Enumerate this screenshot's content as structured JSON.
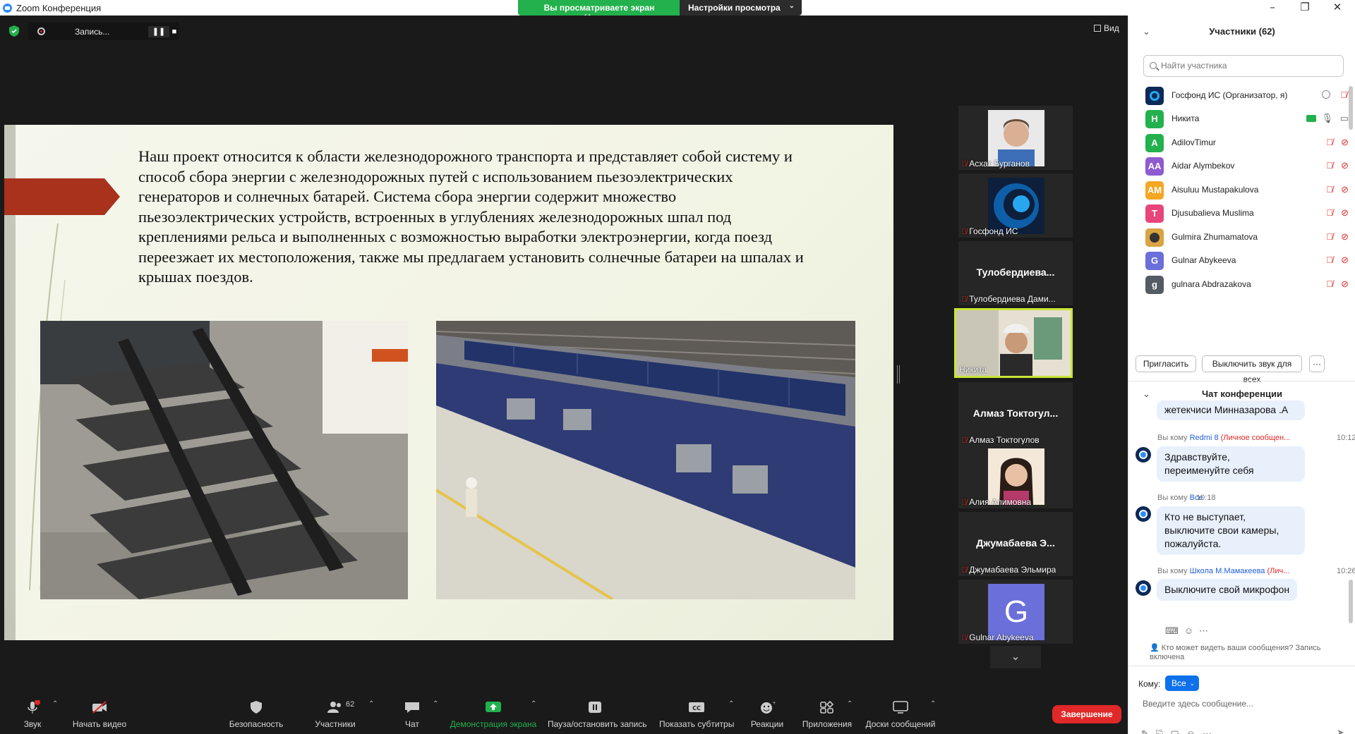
{
  "window": {
    "title": "Zoom Конференция"
  },
  "share_banner": {
    "viewing": "Вы просматриваете экран Никита",
    "options": "Настройки просмотра"
  },
  "recording": {
    "label": "Запись...",
    "pause": "❚❚",
    "stop": "■"
  },
  "view_label": "Вид",
  "slide": {
    "text": "Наш  проект относится к области железнодорожного транспорта и представляет собой систему и способ сбора энергии с железнодорожных путей с использованием пьезоэлектрических генераторов и солнечных батарей. Система сбора энергии содержит множество пьезоэлектрических устройств, встроенных в углублениях железнодорожных шпал под креплениями рельса и выполненных с возможностью выработки электроэнергии, когда поезд переезжает их местоположения, также мы предлагаем установить солнечные батареи на шпалах и крышах поездов."
  },
  "gallery": [
    {
      "name": "Асхат Бурганов",
      "type": "photo",
      "muted": true
    },
    {
      "name": "Госфонд ИС",
      "type": "logo",
      "muted": true
    },
    {
      "name": "Тулобердиева Дами...",
      "big": "Тулобердиева...",
      "type": "text",
      "muted": true
    },
    {
      "name": "Никита",
      "type": "photo-active",
      "muted": false
    },
    {
      "name": "Алмаз Токтогулов",
      "big": "Алмаз Токтогул...",
      "type": "text",
      "muted": true
    },
    {
      "name": "Алия Алимовна",
      "type": "photo",
      "muted": true
    },
    {
      "name": "Джумабаева Эльмира",
      "big": "Джумабаева Э...",
      "type": "text",
      "muted": true
    },
    {
      "name": "Gulnar Abykeeva",
      "type": "letter",
      "letter": "G",
      "muted": true
    }
  ],
  "toolbar": {
    "audio": "Звук",
    "video": "Начать видео",
    "security": "Безопасность",
    "participants": "Участники",
    "participants_count": "62",
    "chat": "Чат",
    "share": "Демонстрация экрана",
    "pause_rec": "Пауза/остановить запись",
    "captions": "Показать субтитры",
    "reactions": "Реакции",
    "apps": "Приложения",
    "whiteboard": "Доски сообщений",
    "end": "Завершение"
  },
  "participants_panel": {
    "title": "Участники (62)",
    "search_placeholder": "Найти участника",
    "people": [
      {
        "name": "Госфонд ИС (Организатор, я)",
        "initials": "",
        "color": "#0c2a57",
        "logo": true
      },
      {
        "name": "Никита",
        "initials": "Н",
        "color": "#23b14d",
        "sharing": true
      },
      {
        "name": "AdilovTimur",
        "initials": "A",
        "color": "#23b14d"
      },
      {
        "name": "Aidar Alymbekov",
        "initials": "AA",
        "color": "#8e5bd1"
      },
      {
        "name": "Aisuluu Mustapakulova",
        "initials": "AM",
        "color": "#f5a623"
      },
      {
        "name": "Djusubalieva Muslima",
        "initials": "T",
        "color": "#e8457a"
      },
      {
        "name": "Gulmira Zhumamatova",
        "initials": "",
        "color": "#d9a441",
        "photo": true
      },
      {
        "name": "Gulnar Abykeeva",
        "initials": "G",
        "color": "#6a6fd9"
      },
      {
        "name": "gulnara Abdrazakova",
        "initials": "g",
        "color": "#555b63"
      }
    ],
    "invite": "Пригласить",
    "mute_all": "Выключить звук для всех",
    "more": "···"
  },
  "chat_panel": {
    "title": "Чат конференции",
    "messages": [
      {
        "meta": null,
        "text": "жетекчиси Минназарова .А"
      },
      {
        "meta_prefix": "Вы кому",
        "to": "Redmi 8",
        "priv": "(Личное сообщен...",
        "time": "10:12",
        "text": "Здравствуйте, переименуйте себя"
      },
      {
        "meta_prefix": "Вы кому",
        "to": "Все",
        "priv": "",
        "time": "10:18",
        "text": "Кто не выступает, выключите свои камеры, пожалуйста."
      },
      {
        "meta_prefix": "Вы кому",
        "to": "Школа М.Мамакеева",
        "priv": "(Лич...",
        "time": "10:26",
        "text": "Выключите свой микрофон"
      }
    ],
    "notice": "Кто может видеть ваши сообщения? Запись включена",
    "to_label": "Кому:",
    "to_value": "Все",
    "input_placeholder": "Введите здесь сообщение..."
  }
}
